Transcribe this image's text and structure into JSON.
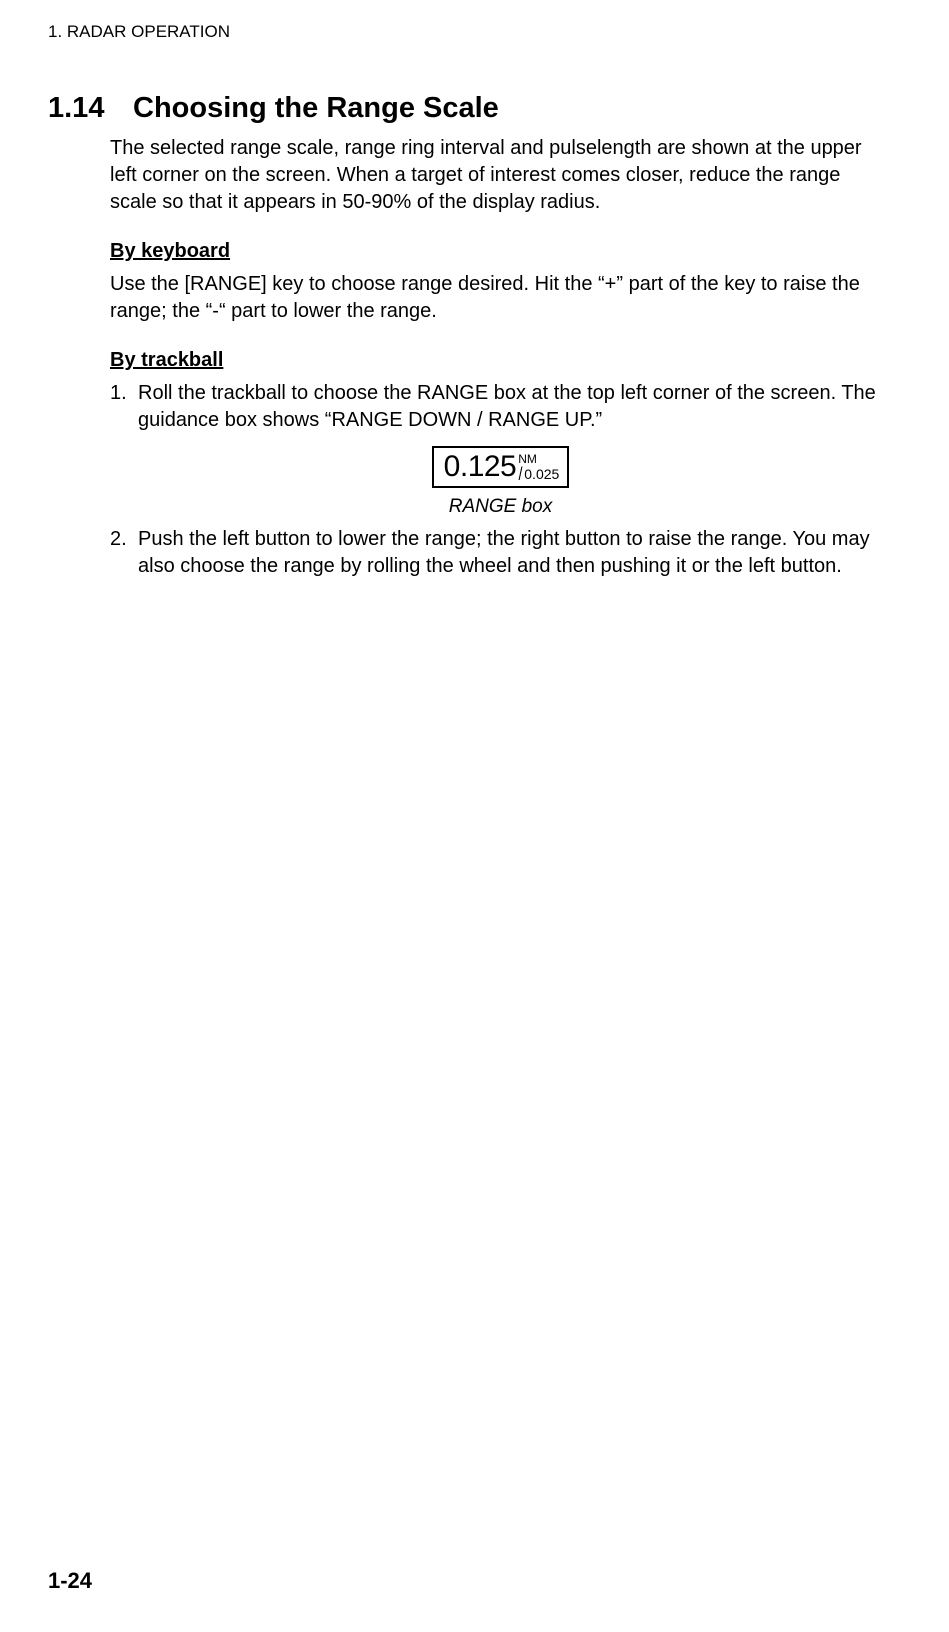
{
  "header": "1. RADAR OPERATION",
  "section": {
    "number": "1.14",
    "title": "Choosing the Range Scale",
    "intro": "The selected range scale, range ring interval and pulselength are shown at the upper left corner on the screen. When a target of interest comes closer, reduce the range scale so that it appears in 50-90% of the display radius."
  },
  "by_keyboard": {
    "heading": "By keyboard",
    "body": "Use the [RANGE] key to choose range desired. Hit the “+” part of the key to raise the range; the “-“ part to lower the range."
  },
  "by_trackball": {
    "heading": "By trackball",
    "step1": {
      "num": "1.",
      "text": "Roll the trackball to choose the RANGE box at the top left corner of the screen. The guidance box shows “RANGE DOWN / RANGE UP.”"
    },
    "range_box": {
      "value": "0.125",
      "unit": "NM",
      "interval": "0.025"
    },
    "caption": "RANGE box",
    "step2": {
      "num": "2.",
      "text": "Push the left button to lower the range; the right button to raise the range. You may also choose the range by rolling the wheel and then pushing it or the left button."
    }
  },
  "footer": "1-24"
}
